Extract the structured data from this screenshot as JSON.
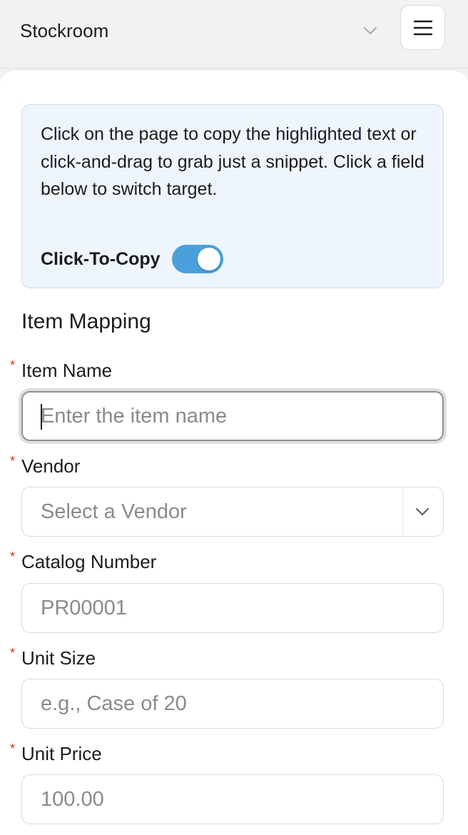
{
  "header": {
    "title": "Stockroom",
    "dropdown_icon": "chevron-down-icon",
    "menu_icon": "hamburger-icon"
  },
  "info": {
    "message": "Click on the page to copy the highlighted text or click-and-drag to grab just a snippet. Click a field below to switch target.",
    "toggle_label": "Click-To-Copy",
    "toggle_on": true
  },
  "form": {
    "section_title": "Item Mapping",
    "required_marker": "*",
    "item_name": {
      "label": "Item Name",
      "placeholder": "Enter the item name",
      "value": ""
    },
    "vendor": {
      "label": "Vendor",
      "placeholder": "Select a Vendor",
      "value": ""
    },
    "catalog_number": {
      "label": "Catalog Number",
      "placeholder": "PR00001",
      "value": ""
    },
    "unit_size": {
      "label": "Unit Size",
      "placeholder": "e.g., Case of 20",
      "value": ""
    },
    "unit_price": {
      "label": "Unit Price",
      "placeholder": "100.00",
      "value": ""
    }
  },
  "colors": {
    "accent": "#4ba0dc",
    "info_bg": "#eef5fd",
    "required": "#d93025"
  }
}
